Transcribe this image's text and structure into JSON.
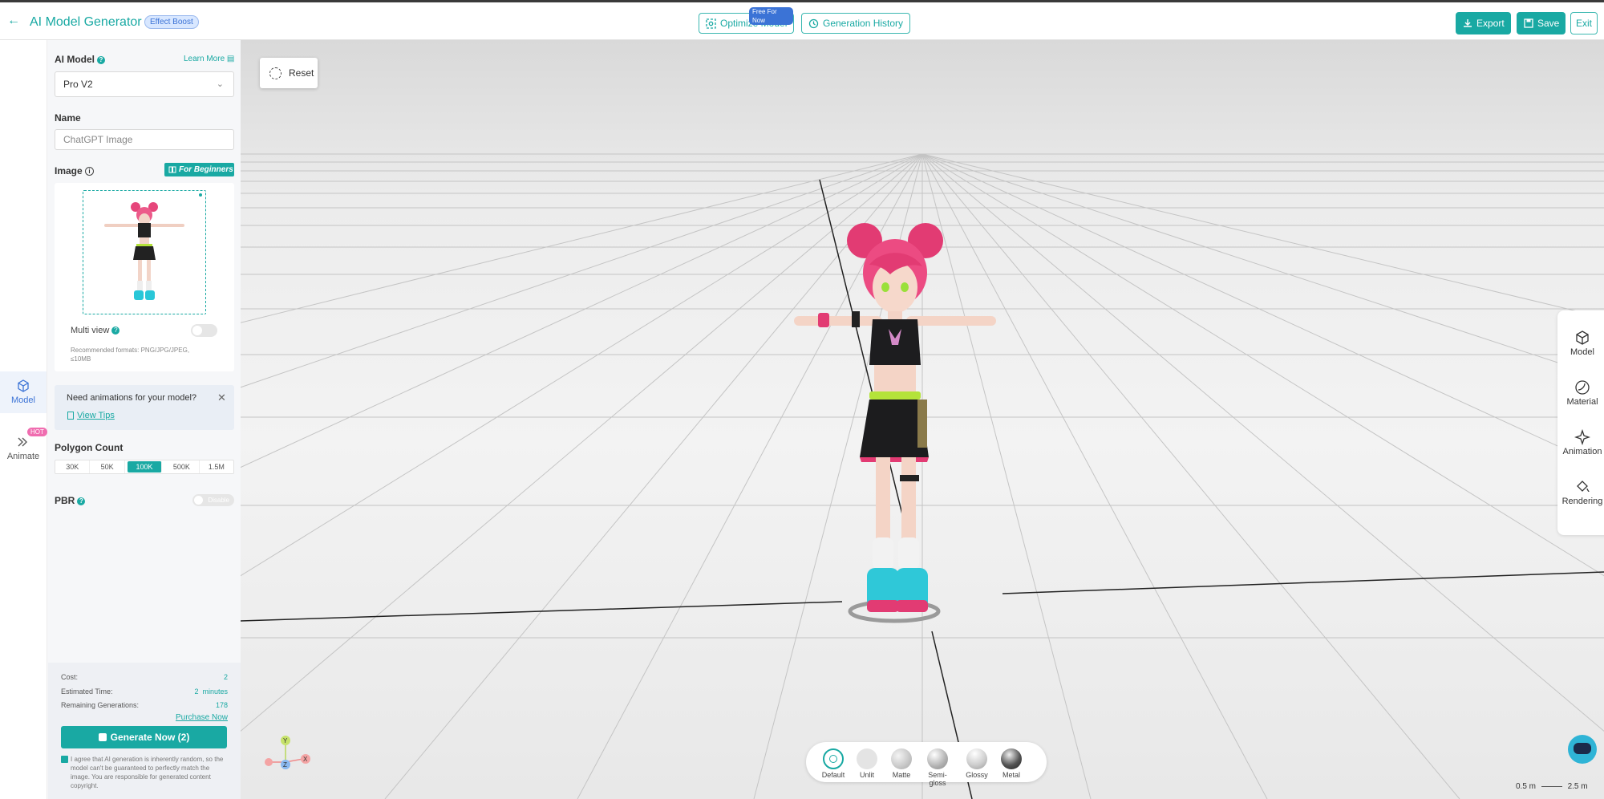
{
  "header": {
    "title": "AI Model Generator",
    "badge": "Effect Boost",
    "optimize_label": "Optimize Model",
    "optimize_tag": "Free For Now",
    "history_label": "Generation History",
    "export_label": "Export",
    "save_label": "Save",
    "exit_label": "Exit"
  },
  "rail": {
    "model_label": "Model",
    "animate_label": "Animate",
    "hot_badge": "HOT"
  },
  "panel": {
    "ai_model_label": "AI Model",
    "learn_more": "Learn More",
    "ai_model_value": "Pro V2",
    "name_label": "Name",
    "name_value": "ChatGPT Image",
    "image_label": "Image",
    "beginners_label": "For Beginners",
    "multi_view_label": "Multi view",
    "formats_text": "Recommended formats: PNG/JPG/JPEG, ≤10MB",
    "anim_prompt": "Need animations for your model?",
    "view_tips": "View Tips",
    "polygon_label": "Polygon Count",
    "polygon_options": [
      "30K",
      "50K",
      "100K",
      "500K",
      "1.5M"
    ],
    "polygon_selected": "100K",
    "pbr_label": "PBR",
    "pbr_toggle": "Disable"
  },
  "footer": {
    "cost_label": "Cost:",
    "cost_value": "2",
    "time_label": "Estimated Time:",
    "time_value": "2  minutes",
    "remaining_label": "Remaining Generations:",
    "remaining_value": "178",
    "purchase": "Purchase Now",
    "generate": "Generate Now (2)",
    "agree_text": "I agree that AI generation is inherently random, so the model can't be guaranteed to perfectly match the image. You are responsible for generated content copyright."
  },
  "viewport": {
    "reset_label": "Reset",
    "tools": [
      "Model",
      "Material",
      "Animation",
      "Rendering"
    ],
    "materials": [
      "Default",
      "Unlit",
      "Matte",
      "Semi-gloss",
      "Glossy",
      "Metal"
    ],
    "scale_small": "0.5 m",
    "scale_large": "2.5 m",
    "axis_labels": {
      "y": "Y",
      "z": "Z",
      "x": "X"
    },
    "accent": "#19a9a3"
  }
}
